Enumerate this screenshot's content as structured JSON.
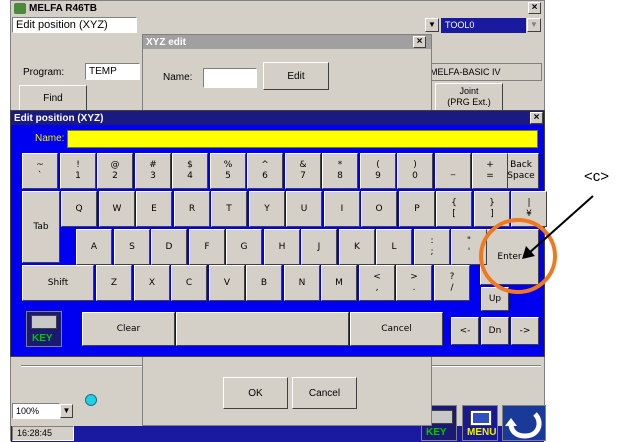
{
  "app": {
    "title": "MELFA R46TB",
    "menu_value": "Edit position (XYZ)",
    "tool_value": "TOOL0",
    "program_label": "Program:",
    "program_value": "TEMP",
    "language_value": "MELFA-BASIC IV",
    "find_label": "Find",
    "joint_label": "Joint\n(PRG Ext.)",
    "zoom_value": "100%",
    "clock": "16:28:45",
    "close_glyph": "×"
  },
  "xyz_dialog": {
    "title": "XYZ edit",
    "name_label": "Name:",
    "name_value": "",
    "edit_label": "Edit",
    "ok_label": "OK",
    "cancel_label": "Cancel"
  },
  "keyboard": {
    "title": "Edit position (XYZ)",
    "name_label": "Name:",
    "name_value": "",
    "row1": [
      {
        "top": "~",
        "bot": "`"
      },
      {
        "top": "!",
        "bot": "1"
      },
      {
        "top": "@",
        "bot": "2"
      },
      {
        "top": "#",
        "bot": "3"
      },
      {
        "top": "$",
        "bot": "4"
      },
      {
        "top": "%",
        "bot": "5"
      },
      {
        "top": "^",
        "bot": "6"
      },
      {
        "top": "&",
        "bot": "7"
      },
      {
        "top": "*",
        "bot": "8"
      },
      {
        "top": "(",
        "bot": "9"
      },
      {
        "top": ")",
        "bot": "0"
      },
      {
        "top": "",
        "bot": "_"
      },
      {
        "top": "+",
        "bot": "="
      }
    ],
    "backspace_label": "Back\nSpace",
    "tab_label": "Tab",
    "row2": [
      "Q",
      "W",
      "E",
      "R",
      "T",
      "Y",
      "U",
      "I",
      "O",
      "P"
    ],
    "row2_extra": [
      {
        "top": "{",
        "bot": "["
      },
      {
        "top": "}",
        "bot": "]"
      },
      {
        "top": "|",
        "bot": "¥"
      }
    ],
    "row3": [
      "A",
      "S",
      "D",
      "F",
      "G",
      "H",
      "J",
      "K",
      "L"
    ],
    "row3_extra": [
      {
        "top": ":",
        "bot": ";"
      },
      {
        "top": "\"",
        "bot": "'"
      }
    ],
    "enter_label": "Enter",
    "shift_label": "Shift",
    "row4": [
      "Z",
      "X",
      "C",
      "V",
      "B",
      "N",
      "M"
    ],
    "row4_extra": [
      {
        "top": "<",
        "bot": ","
      },
      {
        "top": ">",
        "bot": "."
      },
      {
        "top": "?",
        "bot": "/"
      }
    ],
    "up_label": "Up",
    "clear_label": "Clear",
    "cancel_label": "Cancel",
    "left_label": "<-",
    "down_label": "Dn",
    "right_label": "->",
    "key_icon_label": "KEY"
  },
  "bottom": {
    "key_label": "KEY",
    "menu_label": "MENU"
  },
  "annotation": {
    "label": "<c>",
    "color": "#f07820"
  }
}
